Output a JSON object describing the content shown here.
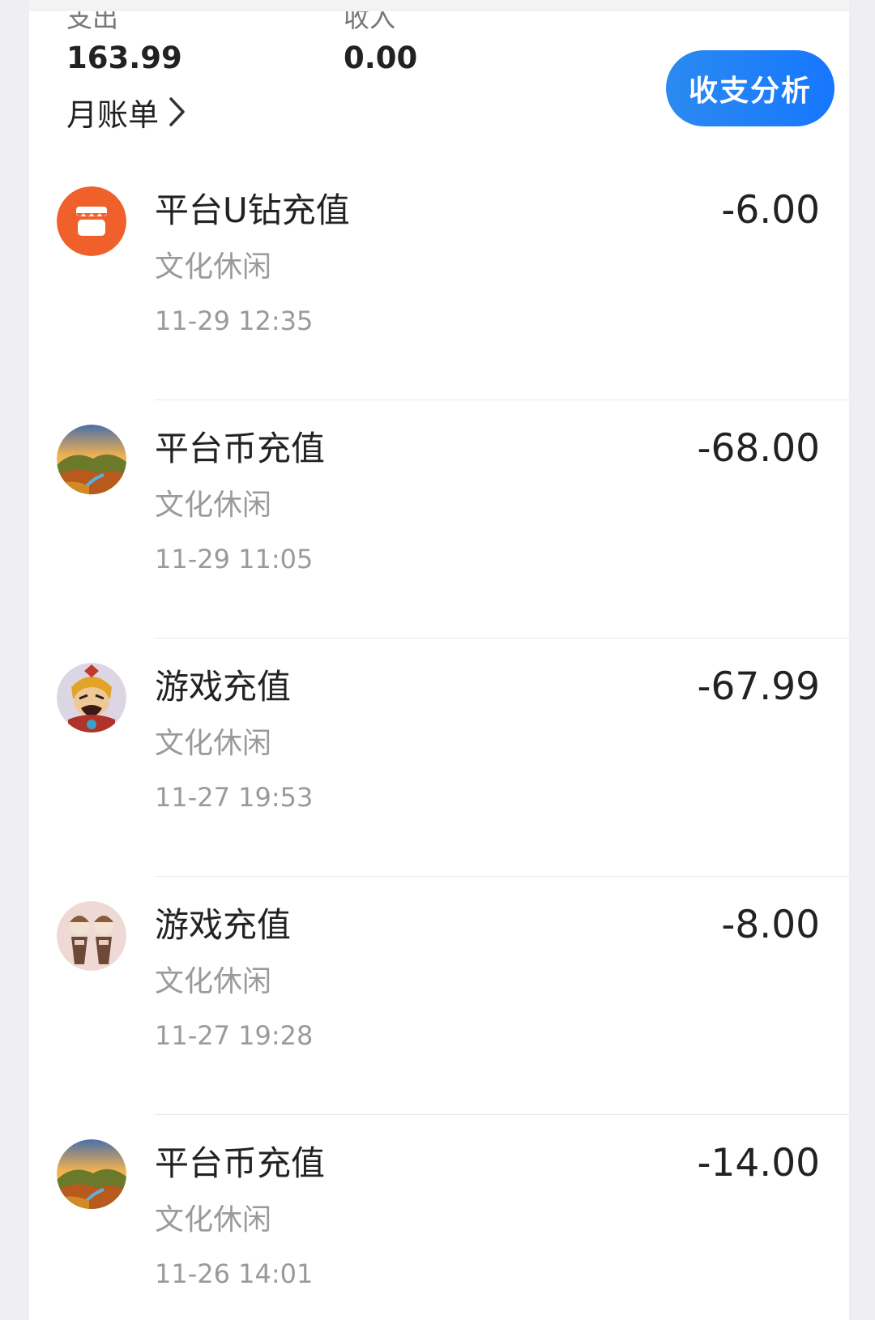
{
  "summary": {
    "expense_label": "支出",
    "expense_value": "163.99",
    "income_label": "收入",
    "income_value": "0.00",
    "monthly_bill": "月账单",
    "analysis_button": "收支分析"
  },
  "colors": {
    "accent": "#1677ff",
    "store_icon": "#f0602a"
  },
  "transactions": [
    {
      "title": "平台U钻充值",
      "category": "文化休闲",
      "time": "11-29 12:35",
      "amount": "-6.00",
      "icon": "store-icon"
    },
    {
      "title": "平台币充值",
      "category": "文化休闲",
      "time": "11-29 11:05",
      "amount": "-68.00",
      "icon": "landscape-avatar"
    },
    {
      "title": "游戏充值",
      "category": "文化休闲",
      "time": "11-27 19:53",
      "amount": "-67.99",
      "icon": "game-character-avatar"
    },
    {
      "title": "游戏充值",
      "category": "文化休闲",
      "time": "11-27 19:28",
      "amount": "-8.00",
      "icon": "anime-characters-avatar"
    },
    {
      "title": "平台币充值",
      "category": "文化休闲",
      "time": "11-26 14:01",
      "amount": "-14.00",
      "icon": "landscape-avatar"
    }
  ]
}
